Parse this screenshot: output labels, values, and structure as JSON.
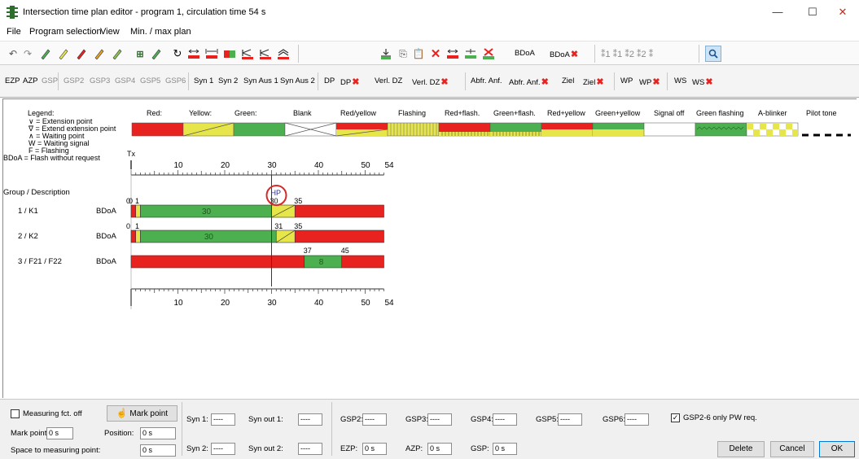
{
  "window": {
    "title": "Intersection time plan editor - program 1, circulation time 54 s",
    "minimize": "—",
    "maximize": "☐",
    "close": "✕"
  },
  "menu": [
    "File",
    "Program selection",
    "View",
    "Min. / max plan"
  ],
  "toolbar1": {
    "bdoa": "BDoA",
    "bdoa_x": "BDoA"
  },
  "toolbar2": {
    "ezp": "EZP",
    "azp": "AZP",
    "gsp": "GSP",
    "gsp2": "GSP2",
    "gsp3": "GSP3",
    "gsp4": "GSP4",
    "gsp5": "GSP5",
    "gsp6": "GSP6",
    "syn1": "Syn 1",
    "syn2": "Syn 2",
    "synaus1": "Syn Aus 1",
    "synaus2": "Syn Aus 2",
    "dp": "DP",
    "dpx": "DP",
    "verldz": "Verl. DZ",
    "verldzx": "Verl. DZ",
    "abfr": "Abfr. Anf.",
    "abfrx": "Abfr. Anf.",
    "ziel": "Ziel",
    "zielx": "Ziel",
    "wp": "WP",
    "wpx": "WP",
    "ws": "WS",
    "wsx": "WS"
  },
  "legend": {
    "title": "Legend:",
    "items": [
      "Red:",
      "Yellow:",
      "Green:",
      "Blank",
      "Red/yellow",
      "Flashing",
      "Red+flash.",
      "Green+flash.",
      "Red+yellow",
      "Green+yellow",
      "Signal off",
      "Green flashing",
      "A-blinker",
      "Pilot tone"
    ],
    "notes": [
      "∨ = Extension point",
      "∇ = Extend extension point",
      "∧ = Waiting point",
      "W = Waiting signal",
      "F = Flashing",
      "BDoA = Flash without request"
    ],
    "tx": "Tx"
  },
  "colors": {
    "red": "#e8231f",
    "yellow": "#e6e64a",
    "green": "#4caf50",
    "cursor": "#2b2ba0",
    "mark": "#d42a2a"
  },
  "timeline": {
    "ticks_top": [
      "10",
      "20",
      "30",
      "40",
      "50",
      "54"
    ],
    "ticks_bottom": [
      "10",
      "20",
      "30",
      "40",
      "50",
      "54"
    ],
    "zero_label": "0",
    "group_header": "Group / Description",
    "cursor_label": "HP",
    "cursor_time": 30
  },
  "groups": [
    {
      "label": "1 / K1",
      "mode": "BDoA",
      "start_label": "1",
      "green_label": "30",
      "edge_a": "30",
      "edge_b": "35",
      "phases": [
        {
          "c": "red",
          "from": 0,
          "to": 1
        },
        {
          "c": "yellow",
          "from": 1,
          "to": 2
        },
        {
          "c": "green",
          "from": 2,
          "to": 30
        },
        {
          "c": "yellow",
          "from": 30,
          "to": 35
        },
        {
          "c": "red",
          "from": 35,
          "to": 54
        }
      ]
    },
    {
      "label": "2 / K2",
      "mode": "BDoA",
      "start_label": "1",
      "green_label": "30",
      "edge_a": "31",
      "edge_b": "35",
      "phases": [
        {
          "c": "red",
          "from": 0,
          "to": 1
        },
        {
          "c": "yellow",
          "from": 1,
          "to": 2
        },
        {
          "c": "green",
          "from": 2,
          "to": 31
        },
        {
          "c": "yellow",
          "from": 31,
          "to": 35
        },
        {
          "c": "red",
          "from": 35,
          "to": 54
        }
      ]
    },
    {
      "label": "3 / F21 / F22",
      "mode": "BDoA",
      "green_label": "8",
      "edge_a": "37",
      "edge_b": "45",
      "phases": [
        {
          "c": "red",
          "from": 0,
          "to": 37
        },
        {
          "c": "green",
          "from": 37,
          "to": 45
        },
        {
          "c": "red",
          "from": 45,
          "to": 54
        }
      ]
    }
  ],
  "status": {
    "measuring": "Measuring fct. off",
    "mark_point_btn": "Mark point",
    "mark_point_label": "Mark point:",
    "mark_point_val": "0 s",
    "position_label": "Position:",
    "position_val": "0 s",
    "space_label": "Space to measuring point:",
    "space_val": "0 s",
    "syn1": "Syn 1:",
    "syn1_val": "----",
    "synout1": "Syn out 1:",
    "synout1_val": "----",
    "syn2": "Syn 2:",
    "syn2_val": "----",
    "synout2": "Syn out 2:",
    "synout2_val": "----",
    "gsp2": "GSP2:",
    "gsp2_val": "----",
    "gsp3": "GSP3:",
    "gsp3_val": "----",
    "gsp4": "GSP4:",
    "gsp4_val": "----",
    "gsp5": "GSP5:",
    "gsp5_val": "----",
    "gsp6": "GSP6:",
    "gsp6_val": "----",
    "gsp_only": "GSP2-6 only PW req.",
    "ezp": "EZP:",
    "ezp_val": "0 s",
    "azp": "AZP:",
    "azp_val": "0 s",
    "gsp": "GSP:",
    "gsp_val": "0 s",
    "delete": "Delete",
    "cancel": "Cancel",
    "ok": "OK"
  }
}
